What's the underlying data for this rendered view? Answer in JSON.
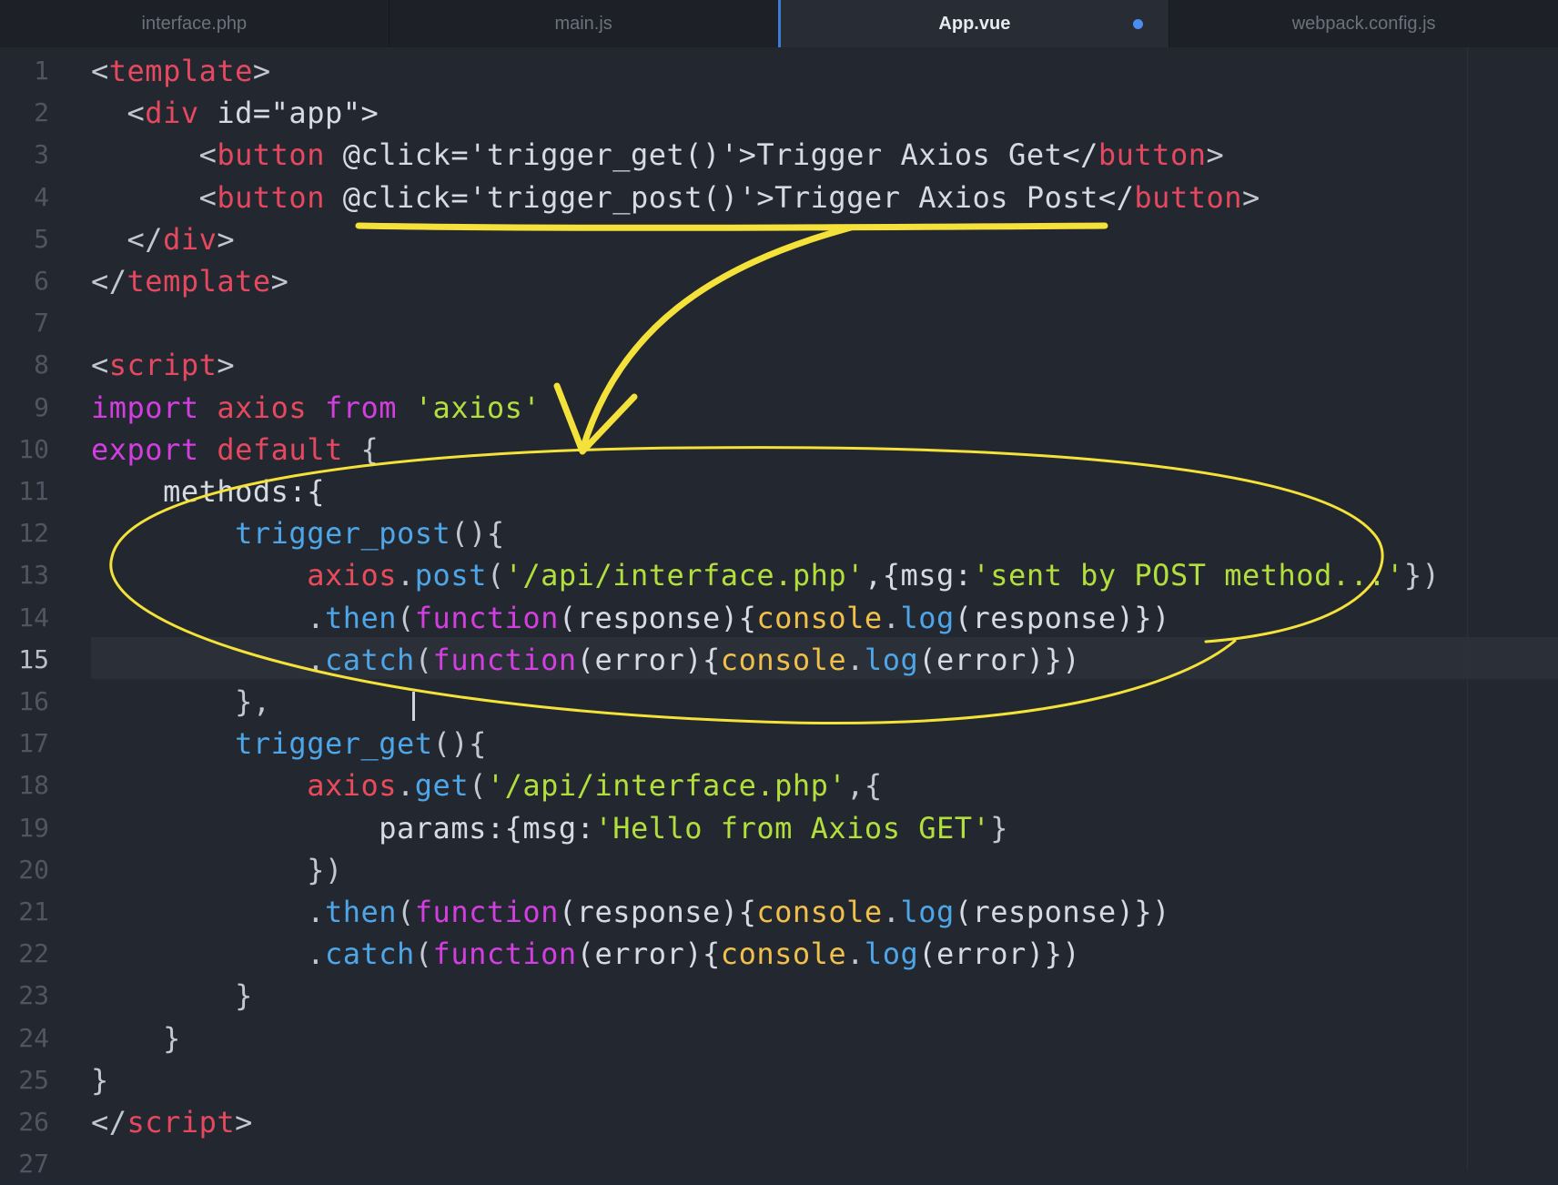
{
  "tabs": [
    {
      "label": "interface.php",
      "active": false,
      "modified": false
    },
    {
      "label": "main.js",
      "active": false,
      "modified": false
    },
    {
      "label": "App.vue",
      "active": true,
      "modified": true
    },
    {
      "label": "webpack.config.js",
      "active": false,
      "modified": false
    }
  ],
  "editor": {
    "active_line": 15,
    "line_numbers": [
      "1",
      "2",
      "3",
      "4",
      "5",
      "6",
      "7",
      "8",
      "9",
      "10",
      "11",
      "12",
      "13",
      "14",
      "15",
      "16",
      "17",
      "18",
      "19",
      "20",
      "21",
      "22",
      "23",
      "24",
      "25",
      "26",
      "27"
    ],
    "lines": [
      [
        {
          "t": "<",
          "c": "punc"
        },
        {
          "t": "template",
          "c": "tag"
        },
        {
          "t": ">",
          "c": "punc"
        }
      ],
      [
        {
          "t": "  <",
          "c": "punc"
        },
        {
          "t": "div",
          "c": "tag"
        },
        {
          "t": " id=\"app\">",
          "c": "id"
        }
      ],
      [
        {
          "t": "      <",
          "c": "punc"
        },
        {
          "t": "button",
          "c": "tag"
        },
        {
          "t": " @click='trigger_get()'>Trigger Axios Get</",
          "c": "id"
        },
        {
          "t": "button",
          "c": "tag"
        },
        {
          "t": ">",
          "c": "punc"
        }
      ],
      [
        {
          "t": "      <",
          "c": "punc"
        },
        {
          "t": "button",
          "c": "tag"
        },
        {
          "t": " @click='trigger_post()'>Trigger Axios Post</",
          "c": "id"
        },
        {
          "t": "button",
          "c": "tag"
        },
        {
          "t": ">",
          "c": "punc"
        }
      ],
      [
        {
          "t": "  </",
          "c": "punc"
        },
        {
          "t": "div",
          "c": "tag"
        },
        {
          "t": ">",
          "c": "punc"
        }
      ],
      [
        {
          "t": "</",
          "c": "punc"
        },
        {
          "t": "template",
          "c": "tag"
        },
        {
          "t": ">",
          "c": "punc"
        }
      ],
      [],
      [
        {
          "t": "<",
          "c": "punc"
        },
        {
          "t": "script",
          "c": "tag"
        },
        {
          "t": ">",
          "c": "punc"
        }
      ],
      [
        {
          "t": "import",
          "c": "kw"
        },
        {
          "t": " axios ",
          "c": "kw2"
        },
        {
          "t": "from",
          "c": "kw"
        },
        {
          "t": " 'axios'",
          "c": "str"
        }
      ],
      [
        {
          "t": "export",
          "c": "kw"
        },
        {
          "t": " default",
          "c": "kw2"
        },
        {
          "t": " {",
          "c": "punc"
        }
      ],
      [
        {
          "t": "    methods:{",
          "c": "id"
        }
      ],
      [
        {
          "t": "        trigger_post",
          "c": "fn"
        },
        {
          "t": "(){",
          "c": "punc"
        }
      ],
      [
        {
          "t": "            axios",
          "c": "obj"
        },
        {
          "t": ".",
          "c": "punc"
        },
        {
          "t": "post",
          "c": "fn"
        },
        {
          "t": "(",
          "c": "punc"
        },
        {
          "t": "'/api/interface.php'",
          "c": "str"
        },
        {
          "t": ",{msg:",
          "c": "id"
        },
        {
          "t": "'sent by POST method...'",
          "c": "str"
        },
        {
          "t": "})",
          "c": "punc"
        }
      ],
      [
        {
          "t": "            .",
          "c": "punc"
        },
        {
          "t": "then",
          "c": "fn"
        },
        {
          "t": "(",
          "c": "punc"
        },
        {
          "t": "function",
          "c": "kw"
        },
        {
          "t": "(response){",
          "c": "id"
        },
        {
          "t": "console",
          "c": "con"
        },
        {
          "t": ".",
          "c": "punc"
        },
        {
          "t": "log",
          "c": "fn"
        },
        {
          "t": "(response)})",
          "c": "id"
        }
      ],
      [
        {
          "t": "            .",
          "c": "punc"
        },
        {
          "t": "catch",
          "c": "fn"
        },
        {
          "t": "(",
          "c": "punc"
        },
        {
          "t": "function",
          "c": "kw"
        },
        {
          "t": "(error){",
          "c": "id"
        },
        {
          "t": "console",
          "c": "con"
        },
        {
          "t": ".",
          "c": "punc"
        },
        {
          "t": "log",
          "c": "fn"
        },
        {
          "t": "(error)})",
          "c": "id"
        }
      ],
      [
        {
          "t": "        },",
          "c": "punc"
        }
      ],
      [
        {
          "t": "        trigger_get",
          "c": "fn"
        },
        {
          "t": "(){",
          "c": "punc"
        }
      ],
      [
        {
          "t": "            axios",
          "c": "obj"
        },
        {
          "t": ".",
          "c": "punc"
        },
        {
          "t": "get",
          "c": "fn"
        },
        {
          "t": "(",
          "c": "punc"
        },
        {
          "t": "'/api/interface.php'",
          "c": "str"
        },
        {
          "t": ",{",
          "c": "punc"
        }
      ],
      [
        {
          "t": "                params:{msg:",
          "c": "id"
        },
        {
          "t": "'Hello from Axios GET'",
          "c": "str"
        },
        {
          "t": "}",
          "c": "punc"
        }
      ],
      [
        {
          "t": "            })",
          "c": "punc"
        }
      ],
      [
        {
          "t": "            .",
          "c": "punc"
        },
        {
          "t": "then",
          "c": "fn"
        },
        {
          "t": "(",
          "c": "punc"
        },
        {
          "t": "function",
          "c": "kw"
        },
        {
          "t": "(response){",
          "c": "id"
        },
        {
          "t": "console",
          "c": "con"
        },
        {
          "t": ".",
          "c": "punc"
        },
        {
          "t": "log",
          "c": "fn"
        },
        {
          "t": "(response)})",
          "c": "id"
        }
      ],
      [
        {
          "t": "            .",
          "c": "punc"
        },
        {
          "t": "catch",
          "c": "fn"
        },
        {
          "t": "(",
          "c": "punc"
        },
        {
          "t": "function",
          "c": "kw"
        },
        {
          "t": "(error){",
          "c": "id"
        },
        {
          "t": "console",
          "c": "con"
        },
        {
          "t": ".",
          "c": "punc"
        },
        {
          "t": "log",
          "c": "fn"
        },
        {
          "t": "(error)})",
          "c": "id"
        }
      ],
      [
        {
          "t": "        }",
          "c": "punc"
        }
      ],
      [
        {
          "t": "    }",
          "c": "punc"
        }
      ],
      [
        {
          "t": "}",
          "c": "punc"
        }
      ],
      [
        {
          "t": "</",
          "c": "punc"
        },
        {
          "t": "script",
          "c": "tag"
        },
        {
          "t": ">",
          "c": "punc"
        }
      ],
      []
    ]
  },
  "annotation": {
    "color": "#f4e13a",
    "marks": [
      "underline",
      "curved-arrow",
      "ellipse"
    ]
  }
}
